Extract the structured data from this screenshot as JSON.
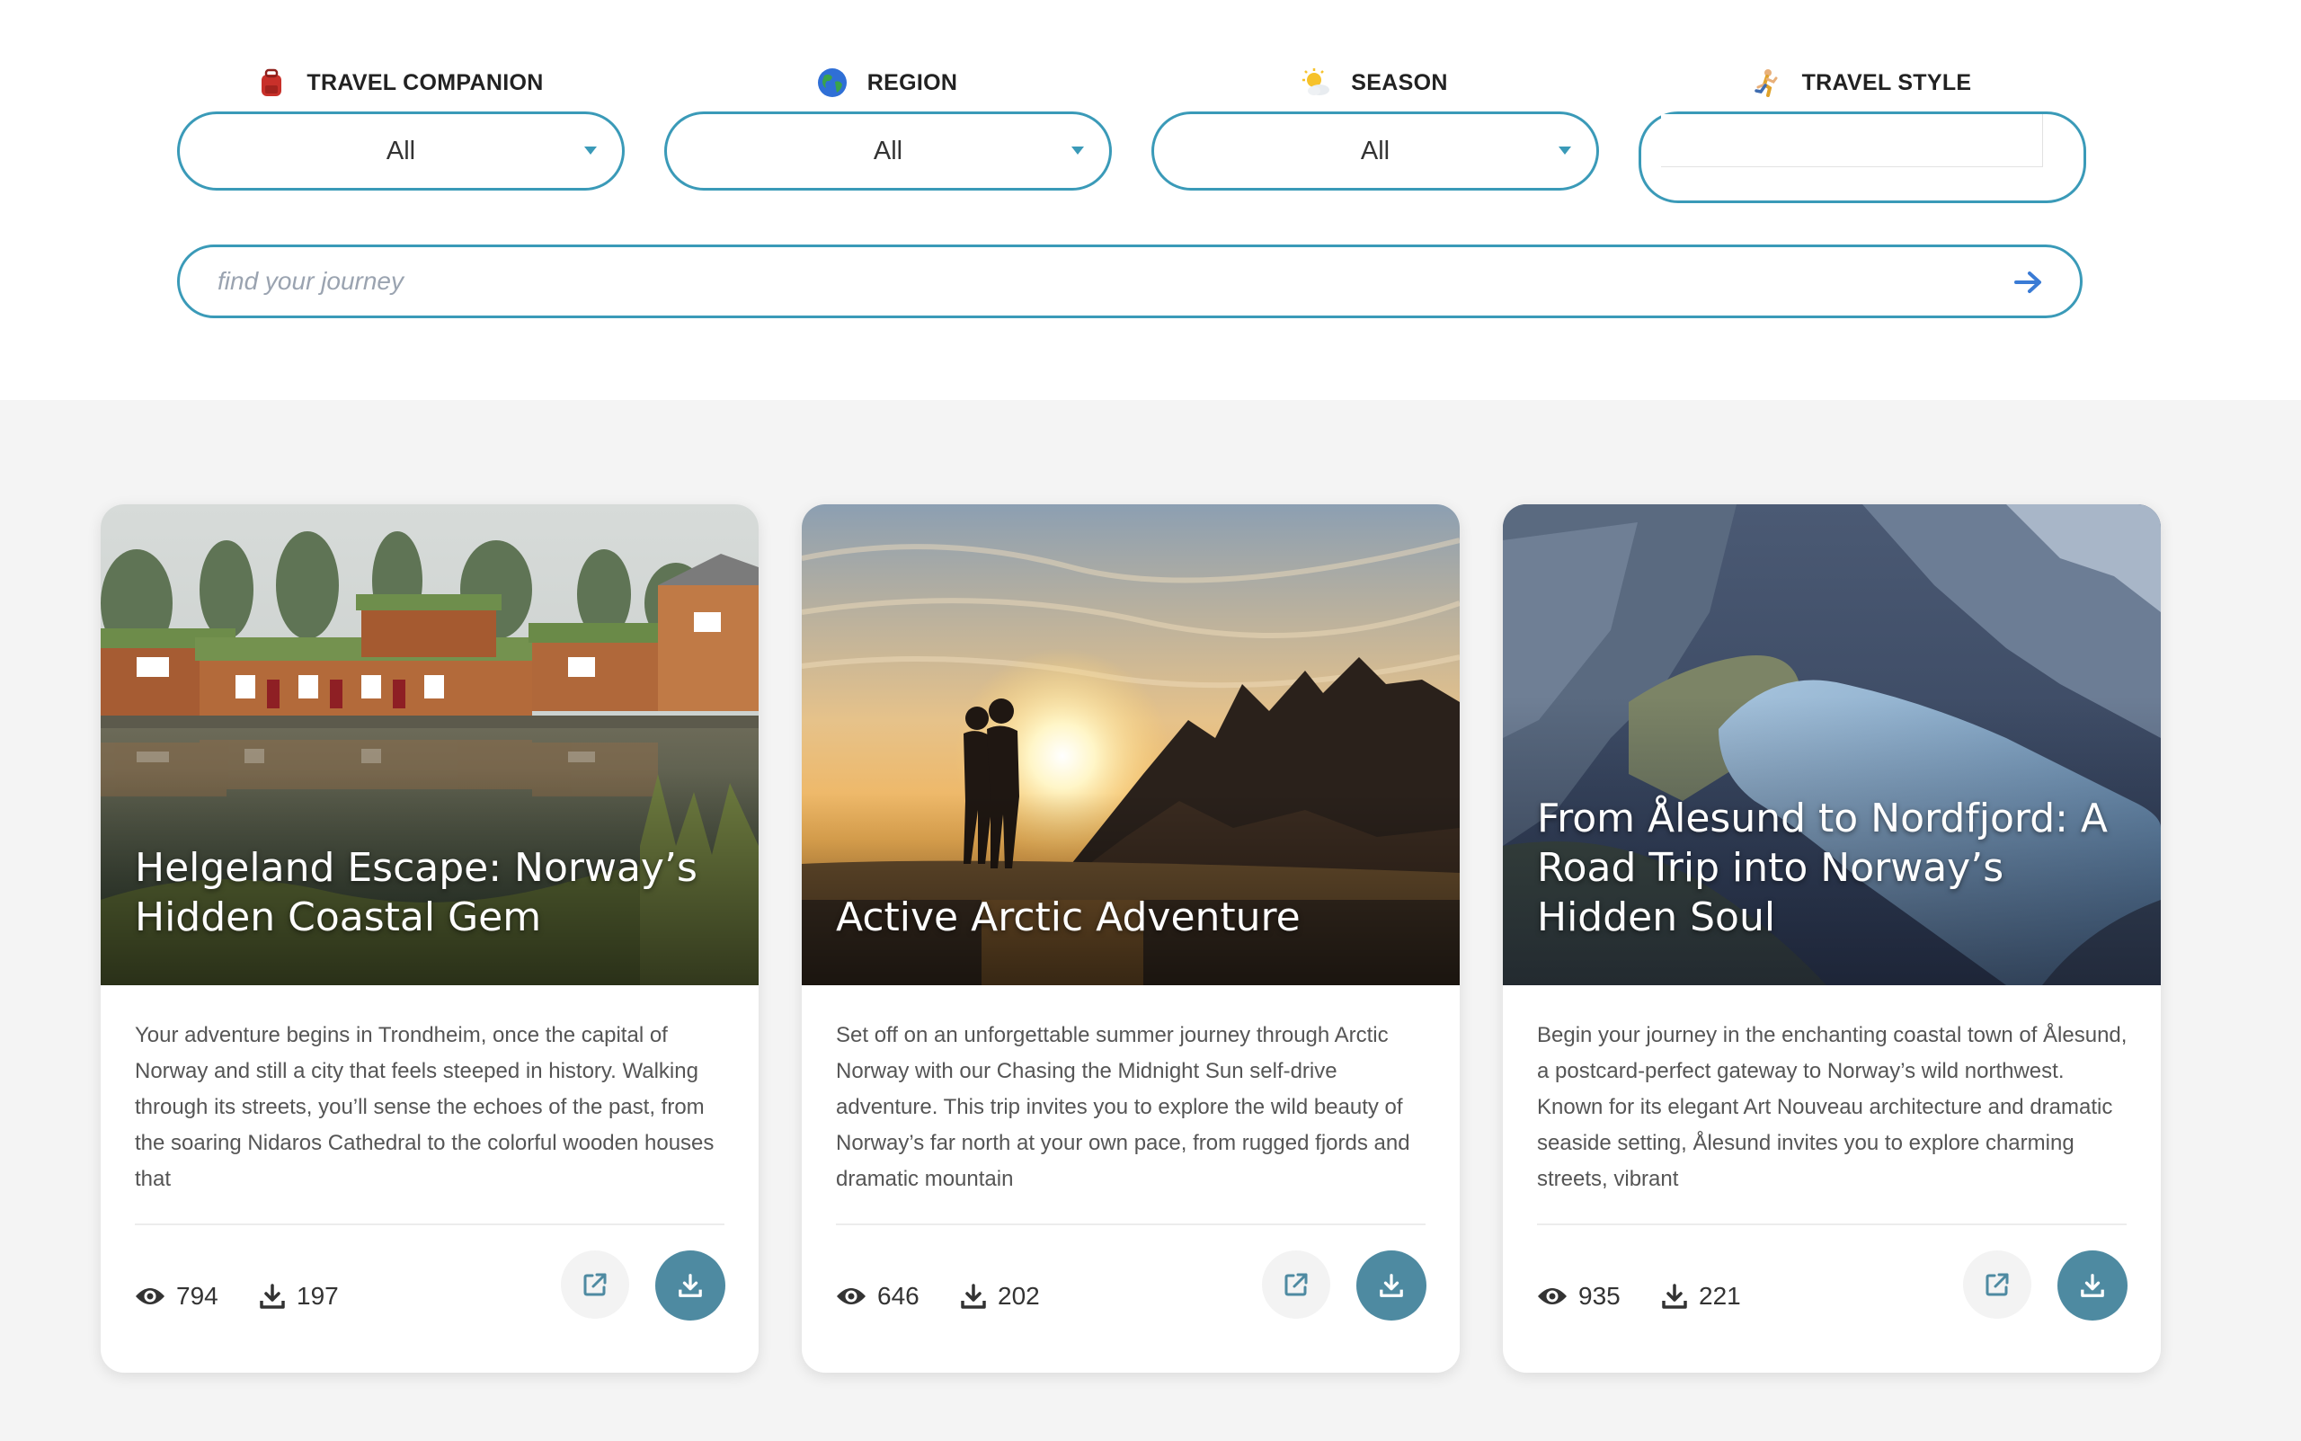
{
  "filters": [
    {
      "label": "TRAVEL COMPANION",
      "icon": "backpack-icon",
      "value": "All"
    },
    {
      "label": "REGION",
      "icon": "globe-icon",
      "value": "All"
    },
    {
      "label": "SEASON",
      "icon": "sun-cloud-icon",
      "value": "All"
    },
    {
      "label": "TRAVEL STYLE",
      "icon": "runner-icon",
      "value": ""
    }
  ],
  "search": {
    "placeholder": "find your journey",
    "icon": "arrow-right-icon"
  },
  "cards": [
    {
      "title": "Helgeland Escape: Norway’s Hidden Coastal Gem",
      "description": "Your adventure begins in Trondheim, once the capital of Norway and still a city that feels steeped in history. Walking through its streets, you’ll sense the echoes of the past, from the soaring Nidaros Cathedral to the colorful wooden houses that",
      "views": "794",
      "downloads": "197"
    },
    {
      "title": "Active Arctic Adventure",
      "description": "Set off on an unforgettable summer journey through Arctic Norway with our Chasing the Midnight Sun self-drive adventure. This trip invites you to explore the wild beauty of Norway’s far north at your own pace, from rugged fjords and dramatic mountain",
      "views": "646",
      "downloads": "202"
    },
    {
      "title": "From Ålesund to Nordfjord: A Road Trip into Norway’s Hidden Soul",
      "description": "Begin your journey in the enchanting coastal town of Ålesund, a postcard-perfect gateway to Norway’s wild northwest. Known for its elegant Art Nouveau architecture and dramatic seaside setting, Ålesund invites you to explore charming streets, vibrant",
      "views": "935",
      "downloads": "221"
    }
  ],
  "colors": {
    "accent": "#3a9ab8",
    "download_button": "#4e8aa1",
    "page_bg": "#f4f4f4"
  }
}
